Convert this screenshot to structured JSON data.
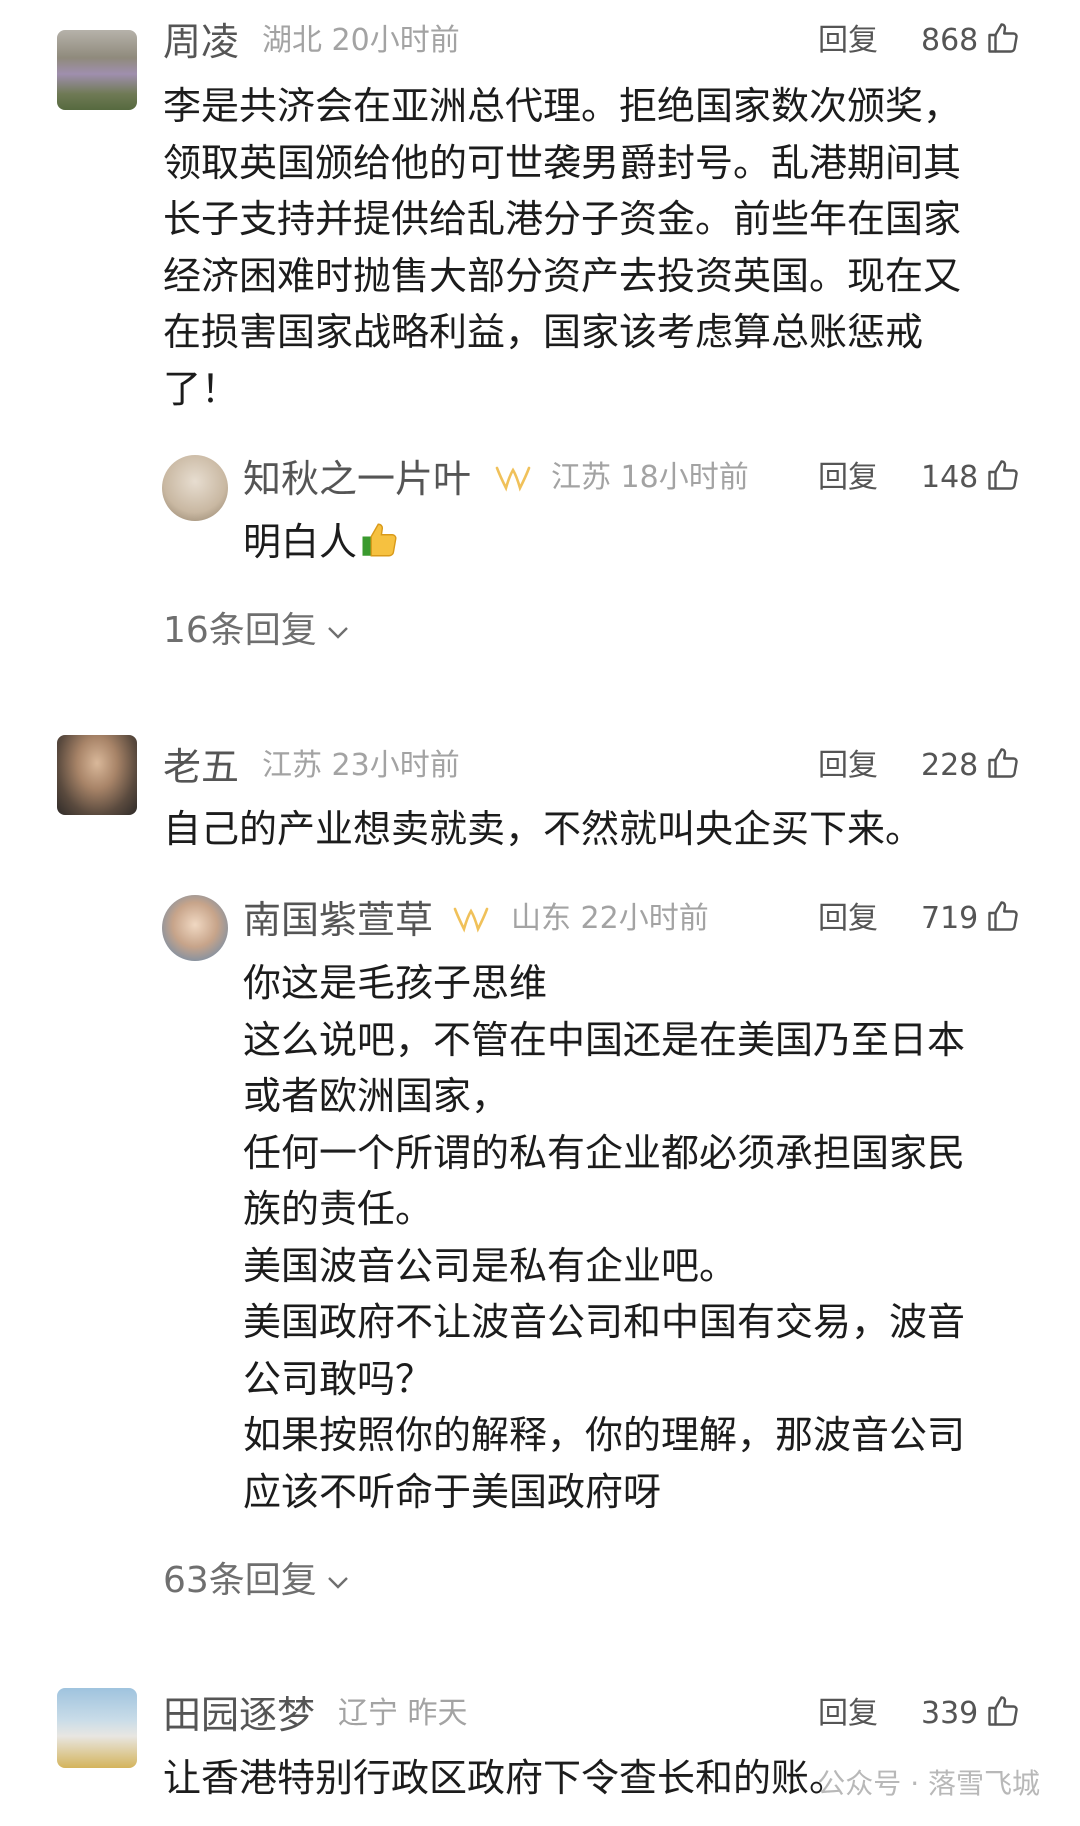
{
  "comments": [
    {
      "user": "周凌",
      "location": "湖北",
      "time": "20小时前",
      "reply_label": "回复",
      "likes": "868",
      "text": "李是共济会在亚洲总代理。拒绝国家数次颁奖，\n领取英国颁给他的可世袭男爵封号。乱港期间其\n长子支持并提供给乱港分子资金。前些年在国家\n经济困难时抛售大部分资产去投资英国。现在又\n在损害国家战略利益，国家该考虑算总账惩戒\n了！",
      "sub_reply": {
        "user": "知秋之一片叶",
        "location": "江苏",
        "time": "18小时前",
        "reply_label": "回复",
        "likes": "148",
        "text": "明白人"
      },
      "more_replies": "16条回复"
    },
    {
      "user": "老五",
      "location": "江苏",
      "time": "23小时前",
      "reply_label": "回复",
      "likes": "228",
      "text": "自己的产业想卖就卖，不然就叫央企买下来。",
      "sub_reply": {
        "user": "南国紫萱草",
        "location": "山东",
        "time": "22小时前",
        "reply_label": "回复",
        "likes": "719",
        "text": "你这是毛孩子思维\n这么说吧，不管在中国还是在美国乃至日本\n或者欧洲国家，\n任何一个所谓的私有企业都必须承担国家民\n族的责任。\n美国波音公司是私有企业吧。\n美国政府不让波音公司和中国有交易，波音\n公司敢吗？\n如果按照你的解释，你的理解，那波音公司\n应该不听命于美国政府呀"
      },
      "more_replies": "63条回复"
    },
    {
      "user": "田园逐梦",
      "location": "辽宁",
      "time": "昨天",
      "reply_label": "回复",
      "likes": "339",
      "text": "让香港特别行政区政府下令查长和的账。"
    }
  ],
  "watermark": "公众号 · 落雪飞城",
  "icons": {
    "like": "thumbs-up-outline-icon",
    "emoji": "thumbs-up-emoji-icon",
    "badge": "vip-badge-icon",
    "chevron": "chevron-down-icon"
  },
  "colors": {
    "badge": "#f0c15a",
    "meta": "#a3a3a3"
  }
}
